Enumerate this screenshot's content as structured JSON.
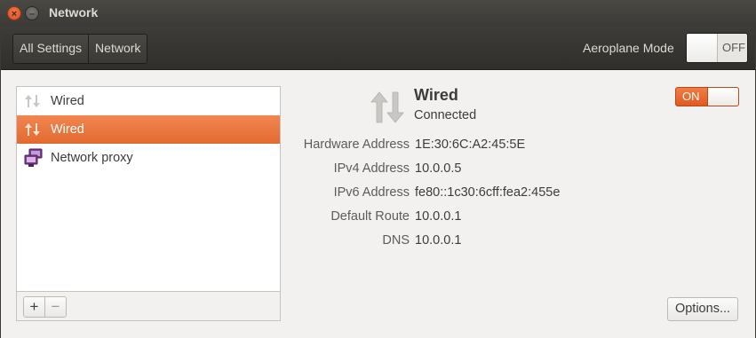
{
  "window": {
    "title": "Network"
  },
  "toolbar": {
    "crumbs": [
      "All Settings",
      "Network"
    ],
    "aeroplane_label": "Aeroplane Mode",
    "aeroplane_state": "OFF"
  },
  "sidebar": {
    "items": [
      {
        "label": "Wired",
        "icon": "wired-icon",
        "selected": false
      },
      {
        "label": "Wired",
        "icon": "wired-icon",
        "selected": true
      },
      {
        "label": "Network proxy",
        "icon": "network-proxy-icon",
        "selected": false
      }
    ],
    "add_label": "+",
    "remove_label": "−"
  },
  "device": {
    "name": "Wired",
    "status": "Connected",
    "switch_state": "ON",
    "details": [
      {
        "label": "Hardware Address",
        "value": "1E:30:6C:A2:45:5E"
      },
      {
        "label": "IPv4 Address",
        "value": "10.0.0.5"
      },
      {
        "label": "IPv6 Address",
        "value": "fe80::1c30:6cff:fea2:455e"
      },
      {
        "label": "Default Route",
        "value": "10.0.0.1"
      },
      {
        "label": "DNS",
        "value": "10.0.0.1"
      }
    ],
    "options_label": "Options..."
  },
  "colors": {
    "accent": "#e9682e",
    "titlebar": "#3b3a36",
    "background": "#f2f1f0"
  }
}
